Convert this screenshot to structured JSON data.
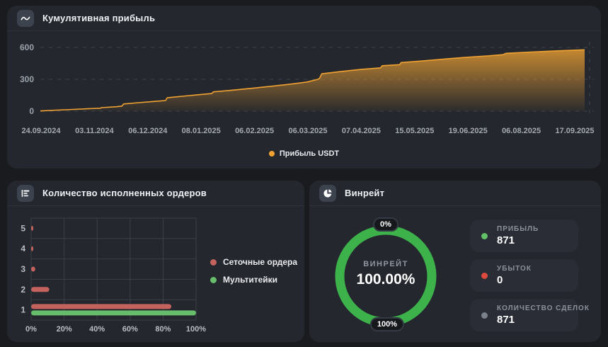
{
  "panels": {
    "cumulative": {
      "title": "Кумулятивная прибыль"
    },
    "orders": {
      "title": "Количество исполненных ордеров"
    },
    "winrate": {
      "title": "Винрейт",
      "center_label": "ВИНРЕЙТ",
      "center_value": "100.00%",
      "badge_top": "0%",
      "badge_bottom": "100%",
      "ring_color": "#3db24b",
      "stats": [
        {
          "label": "ПРИБЫЛЬ",
          "value": "871",
          "dot_color": "#62c165"
        },
        {
          "label": "УБЫТОК",
          "value": "0",
          "dot_color": "#de4a3d"
        },
        {
          "label": "КОЛИЧЕСТВО СДЕЛОК",
          "value": "871",
          "dot_color": "#7b828b"
        }
      ]
    }
  },
  "chart_data": [
    {
      "type": "area",
      "title": "Кумулятивная прибыль",
      "series": [
        {
          "name": "Прибыль USDT",
          "color": "#f0a232"
        }
      ],
      "x_tick_labels": [
        "24.09.2024",
        "03.11.2024",
        "06.12.2024",
        "08.01.2025",
        "06.02.2025",
        "06.03.2025",
        "07.04.2025",
        "15.05.2025",
        "19.06.2025",
        "06.08.2025",
        "17.09.2025"
      ],
      "y_ticks": [
        0,
        300,
        600
      ],
      "ylim": [
        0,
        600
      ],
      "grid": "dashed-horizontal",
      "legend_position": "bottom-center",
      "points": [
        [
          0,
          2
        ],
        [
          0.03,
          10
        ],
        [
          0.06,
          17
        ],
        [
          0.09,
          24
        ],
        [
          0.11,
          28
        ],
        [
          0.113,
          33
        ],
        [
          0.14,
          42
        ],
        [
          0.15,
          48
        ],
        [
          0.153,
          68
        ],
        [
          0.18,
          80
        ],
        [
          0.21,
          92
        ],
        [
          0.23,
          100
        ],
        [
          0.233,
          126
        ],
        [
          0.26,
          140
        ],
        [
          0.29,
          155
        ],
        [
          0.315,
          166
        ],
        [
          0.318,
          182
        ],
        [
          0.35,
          196
        ],
        [
          0.39,
          216
        ],
        [
          0.43,
          238
        ],
        [
          0.46,
          255
        ],
        [
          0.49,
          275
        ],
        [
          0.51,
          300
        ],
        [
          0.513,
          310
        ],
        [
          0.517,
          352
        ],
        [
          0.55,
          372
        ],
        [
          0.59,
          394
        ],
        [
          0.625,
          408
        ],
        [
          0.628,
          428
        ],
        [
          0.66,
          438
        ],
        [
          0.663,
          458
        ],
        [
          0.7,
          472
        ],
        [
          0.74,
          490
        ],
        [
          0.78,
          506
        ],
        [
          0.82,
          520
        ],
        [
          0.85,
          532
        ],
        [
          0.855,
          545
        ],
        [
          0.9,
          557
        ],
        [
          0.95,
          568
        ],
        [
          1,
          578
        ]
      ]
    },
    {
      "type": "bar",
      "orientation": "horizontal",
      "title": "Количество исполненных ордеров",
      "categories": [
        "5",
        "4",
        "3",
        "2",
        "1"
      ],
      "series": [
        {
          "name": "Сеточные ордера",
          "color": "#c4635e",
          "values": [
            1,
            1,
            2.5,
            11,
            85
          ]
        },
        {
          "name": "Мультитейки",
          "color": "#68bd6c",
          "values": [
            0,
            0,
            0,
            0,
            100
          ]
        }
      ],
      "x_tick_labels": [
        "0%",
        "20%",
        "40%",
        "60%",
        "80%",
        "100%"
      ],
      "xlim": [
        0,
        100
      ],
      "grid": "full",
      "legend_position": "right"
    },
    {
      "type": "pie",
      "title": "Винрейт",
      "display_value": "100.00%",
      "segments": [
        {
          "label": "ВИНРЕЙТ",
          "value": 100,
          "color": "#3db24b"
        }
      ],
      "annotations": [
        "0%",
        "100%"
      ]
    }
  ]
}
